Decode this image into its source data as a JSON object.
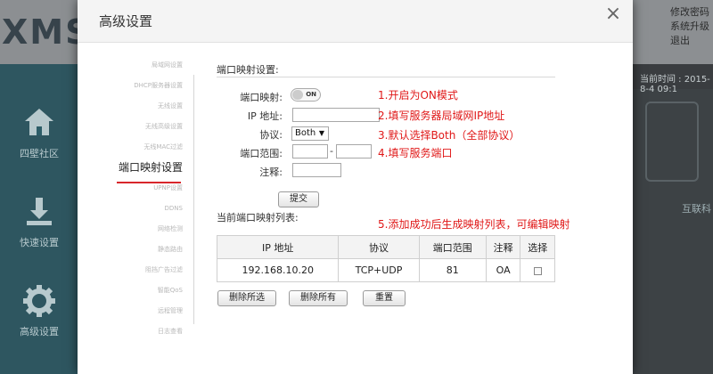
{
  "background": {
    "logo": "XMSV",
    "top_links": [
      "修改密码",
      "系统升级",
      "退出"
    ],
    "time": "当前时间 : 2015-8-4 09:1",
    "nav": [
      {
        "label": "四壁社区",
        "icon": "home-icon"
      },
      {
        "label": "快速设置",
        "icon": "download-icon"
      },
      {
        "label": "高级设置",
        "icon": "gear-icon"
      }
    ],
    "right_label": "互联科"
  },
  "modal": {
    "title": "高级设置",
    "close_label": "×",
    "menu": [
      {
        "label": "局域网设置"
      },
      {
        "label": "DHCP服务器设置"
      },
      {
        "label": "无线设置"
      },
      {
        "label": "无线高级设置"
      },
      {
        "label": "无线MAC过滤"
      },
      {
        "label": "端口映射设置",
        "active": true
      },
      {
        "label": "UPNP设置"
      },
      {
        "label": "DDNS"
      },
      {
        "label": "网络检测"
      },
      {
        "label": "静态路由"
      },
      {
        "label": "阻挡广告过滤"
      },
      {
        "label": "智能QoS"
      },
      {
        "label": "远程管理"
      },
      {
        "label": "日志查看"
      }
    ],
    "form": {
      "section_title": "端口映射设置:",
      "enable_label": "端口映射:",
      "toggle_label": "ON",
      "ip_label": "IP 地址:",
      "ip_value": "",
      "protocol_label": "协议:",
      "protocol_value": "Both",
      "port_range_label": "端口范围:",
      "port_start": "",
      "port_end": "",
      "dash": "-",
      "note_label": "注释:",
      "note_value": "",
      "submit_label": "提交"
    },
    "annotations": [
      "1.开启为ON模式",
      "2.填写服务器局域网IP地址",
      "3.默认选择Both（全部协议）",
      "4.填写服务端口",
      "5.添加成功后生成映射列表，可编辑映射"
    ],
    "list": {
      "title": "当前端口映射列表:",
      "headers": [
        "IP 地址",
        "协议",
        "端口范围",
        "注释",
        "选择"
      ],
      "rows": [
        [
          "192.168.10.20",
          "TCP+UDP",
          "81",
          "OA"
        ]
      ]
    },
    "buttons": {
      "delete_selected": "删除所选",
      "delete_all": "删除所有",
      "reset": "重置"
    }
  }
}
